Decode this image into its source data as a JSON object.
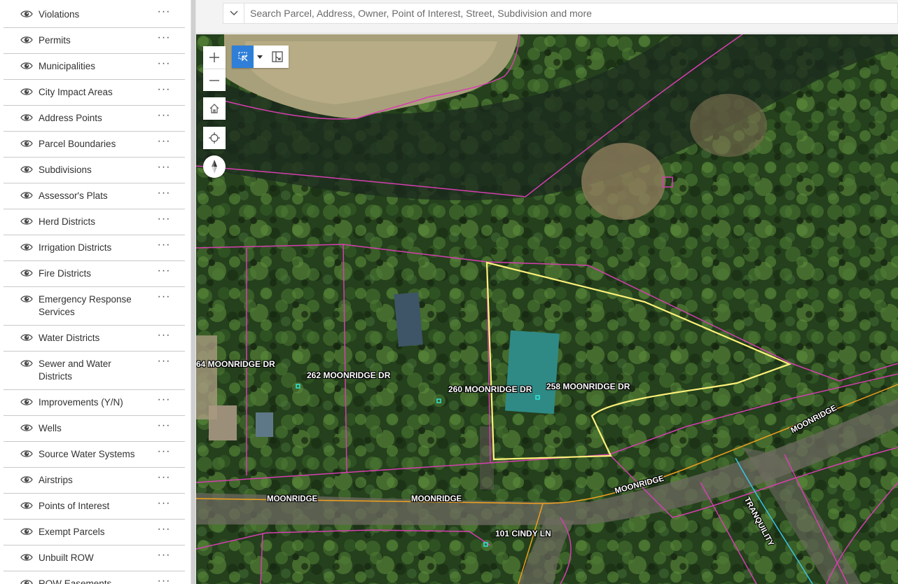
{
  "layers": [
    {
      "label": "Violations"
    },
    {
      "label": "Permits"
    },
    {
      "label": "Municipalities"
    },
    {
      "label": "City Impact Areas"
    },
    {
      "label": "Address Points"
    },
    {
      "label": "Parcel Boundaries"
    },
    {
      "label": "Subdivisions"
    },
    {
      "label": "Assessor's Plats"
    },
    {
      "label": "Herd Districts"
    },
    {
      "label": "Irrigation Districts"
    },
    {
      "label": "Fire Districts"
    },
    {
      "label": "Emergency Response Services"
    },
    {
      "label": "Water Districts"
    },
    {
      "label": "Sewer and Water Districts"
    },
    {
      "label": "Improvements (Y/N)"
    },
    {
      "label": "Wells"
    },
    {
      "label": "Source Water Systems"
    },
    {
      "label": "Airstrips"
    },
    {
      "label": "Points of Interest"
    },
    {
      "label": "Exempt Parcels"
    },
    {
      "label": "Unbuilt ROW"
    },
    {
      "label": "ROW Easements"
    }
  ],
  "layer_more_label": "···",
  "search": {
    "placeholder": "Search Parcel, Address, Owner, Point of Interest, Street, Subdivision and more"
  },
  "map": {
    "address_labels": {
      "a264": "64 MOONRIDGE DR",
      "a262": "262 MOONRIDGE DR",
      "a260": "260 MOONRIDGE DR",
      "a258": "258 MOONRIDGE DR",
      "a101": "101 CINDY LN"
    },
    "road_labels": {
      "moonridge_1": "MOONRIDGE",
      "moonridge_2": "MOONRIDGE",
      "moonridge_3": "MOONRIDGE",
      "moonridge_4": "MOONRIDGE",
      "tranquility": "TRANQUILITY"
    },
    "colors": {
      "parcel_line": "#d63fb0",
      "selected_parcel": "#fff27a",
      "road_line": "#f0a01e",
      "cyan_road": "#37c7e8",
      "address_point": "#2fe6d6",
      "select_tool_active": "#2f7fd8"
    },
    "icons": [
      "zoom-in-icon",
      "zoom-out-icon",
      "home-icon",
      "locate-icon",
      "compass-icon",
      "select-icon",
      "select-by-shape-icon"
    ]
  }
}
